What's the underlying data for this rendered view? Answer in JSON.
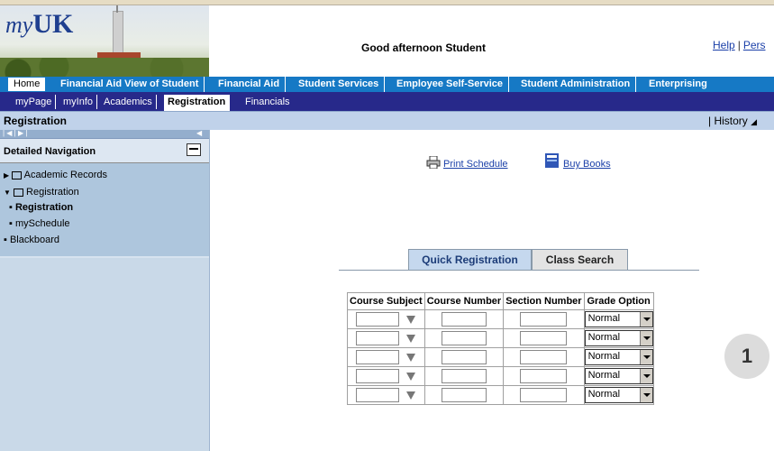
{
  "header": {
    "logo_text": "my",
    "logo_bold": "UK",
    "greeting": "Good afternoon Student",
    "links": {
      "help": "Help",
      "separator": "|",
      "personalize": "Pers"
    }
  },
  "nav_primary": [
    "Home",
    "Financial Aid View of Student",
    "Financial Aid",
    "Student Services",
    "Employee Self-Service",
    "Student Administration",
    "Enterprising"
  ],
  "nav_secondary": [
    "myPage",
    "myInfo",
    "Academics",
    "Registration",
    "Financials"
  ],
  "page": {
    "title": "Registration",
    "history_sep": "|",
    "history": "History"
  },
  "left_panel": {
    "pager": "| ◀ | ▶ |",
    "heading": "Detailed Navigation",
    "tree": [
      "Academic Records",
      "Registration",
      "Registration",
      "mySchedule",
      "Blackboard"
    ]
  },
  "main": {
    "print_schedule": "Print Schedule",
    "buy_books": "Buy Books",
    "tabs": [
      "Quick Registration",
      "Class Search"
    ],
    "table_headers": [
      "Course Subject",
      "Course Number",
      "Section Number",
      "Grade Option"
    ],
    "rows": [
      {
        "subject": "",
        "number": "",
        "section": "",
        "grade": "Normal"
      },
      {
        "subject": "",
        "number": "",
        "section": "",
        "grade": "Normal"
      },
      {
        "subject": "",
        "number": "",
        "section": "",
        "grade": "Normal"
      },
      {
        "subject": "",
        "number": "",
        "section": "",
        "grade": "Normal"
      },
      {
        "subject": "",
        "number": "",
        "section": "",
        "grade": "Normal"
      }
    ],
    "step_badge": "1"
  },
  "colors": {
    "primary_nav": "#1679c5",
    "secondary_nav": "#27298a",
    "title_bar": "#c0d2ea",
    "left_panel": "#c7d9e8",
    "link": "#1a3fa8"
  }
}
